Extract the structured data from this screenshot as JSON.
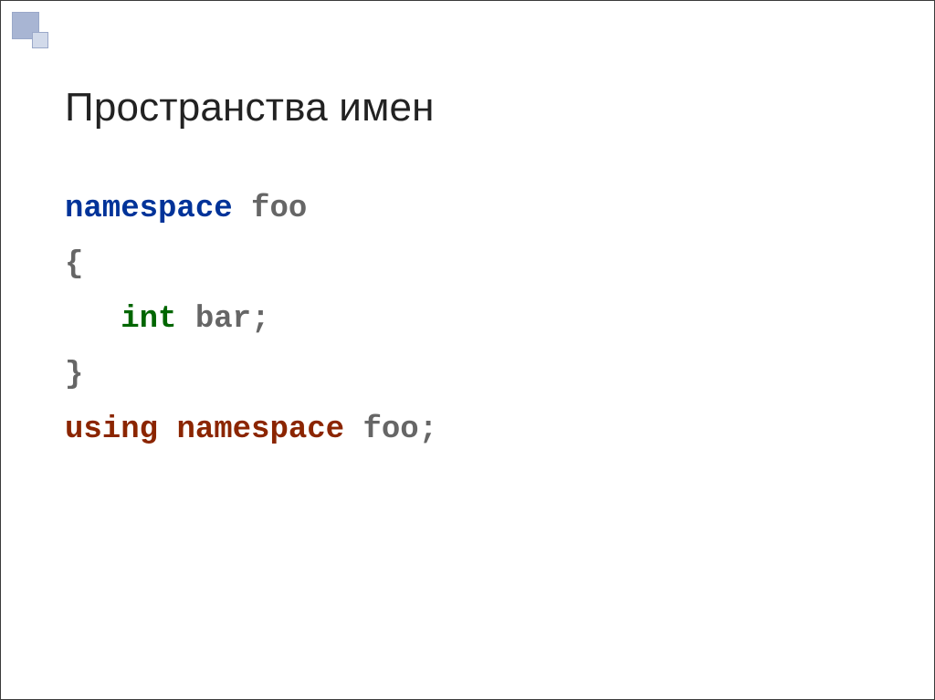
{
  "title": "Пространства имен",
  "code": {
    "line1": {
      "kw": "namespace",
      "sp": " ",
      "ident": "foo"
    },
    "line2": "{",
    "line3": {
      "indent": "   ",
      "kw": "int",
      "sp": " ",
      "ident": "bar",
      "semi": ";"
    },
    "line4": "}",
    "line5": "",
    "line6": "",
    "line7": {
      "kw1": "using",
      "sp1": " ",
      "kw2": "namespace",
      "sp2": " ",
      "ident": "foo",
      "semi": ";"
    }
  }
}
